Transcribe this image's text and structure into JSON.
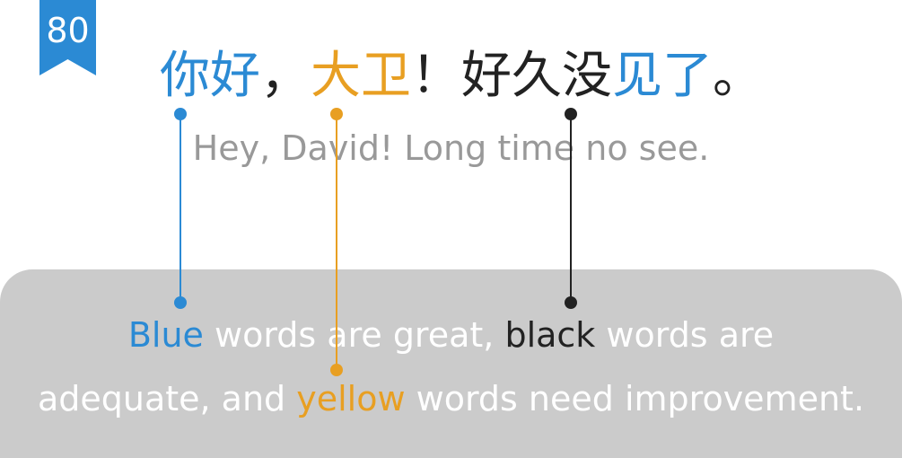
{
  "badge": {
    "number": "80"
  },
  "sentence": {
    "part1": "你好",
    "part2": "，",
    "part3": "大卫",
    "part4": "！好久没",
    "part5": "见了",
    "part6": "。"
  },
  "translation": "Hey, David! Long time no see.",
  "legend": {
    "line1_blue": "Blue",
    "line1_rest1": " words are great, ",
    "line1_black": "black",
    "line1_rest2": " words are",
    "line2_rest1": "adequate, and ",
    "line2_yellow": "yellow",
    "line2_rest2": " words need improvement."
  },
  "colors": {
    "blue": "#2b8ad4",
    "yellow": "#e89f22",
    "black": "#222222",
    "gray": "#999999",
    "panel": "#cbcbcb"
  }
}
